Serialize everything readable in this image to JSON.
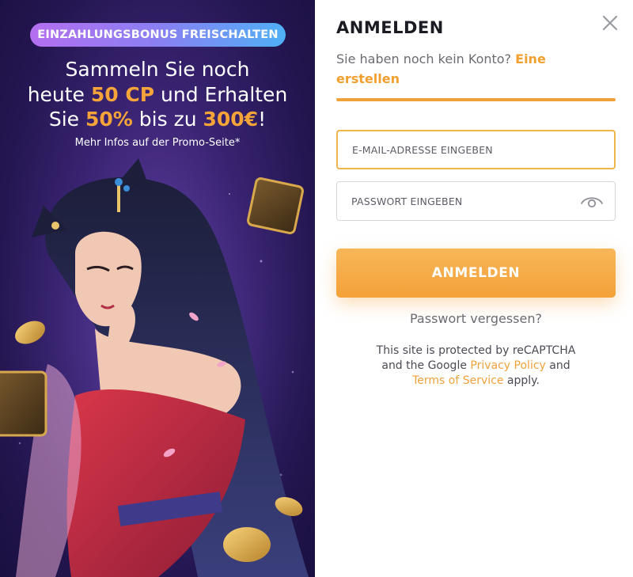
{
  "promo": {
    "badge": "EINZAHLUNGSBONUS FREISCHALTEN",
    "headline_1a": "Sammeln Sie noch",
    "headline_2a": "heute ",
    "headline_2b": "50 CP",
    "headline_2c": " und Erhalten",
    "headline_3a": "Sie ",
    "headline_3b": "50%",
    "headline_3c": " bis zu ",
    "headline_3d": "300€",
    "headline_3e": "!",
    "subline": "Mehr Infos auf der Promo-Seite*"
  },
  "login": {
    "title": "ANMELDEN",
    "register_prefix": "Sie haben noch kein Konto? ",
    "register_link": "Eine erstellen",
    "step_progress": 1.0,
    "email_placeholder": "E-MAIL-ADRESSE EINGEBEN",
    "password_placeholder": "PASSWORT EINGEBEN",
    "submit_label": "ANMELDEN",
    "forgot_password": "Passwort vergessen?",
    "recaptcha_1": "This site is protected by reCAPTCHA",
    "recaptcha_2a": "and the Google ",
    "recaptcha_privacy": "Privacy Policy",
    "recaptcha_2b": " and",
    "recaptcha_terms": "Terms of Service",
    "recaptcha_3": " apply."
  },
  "icons": {
    "close": "close-icon",
    "password_visibility": "eye-icon"
  },
  "colors": {
    "accent": "#f4a138",
    "title": "#1b1b24",
    "muted_text": "#6b6b72",
    "promo_bg": "#2a1a5c"
  }
}
